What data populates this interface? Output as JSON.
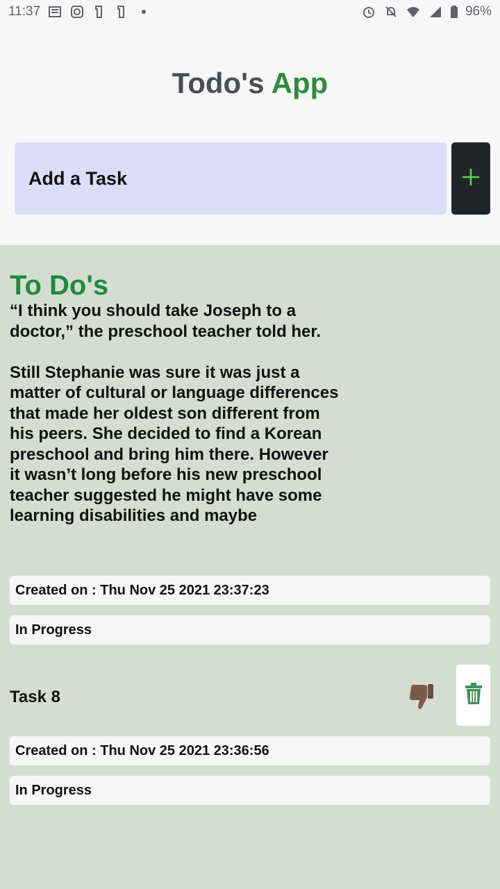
{
  "status_bar": {
    "time": "11:37",
    "battery": "96%",
    "left_icons": [
      "news-icon",
      "instagram-icon",
      "app-icon",
      "app-icon"
    ],
    "right_icons": [
      "alarm-icon",
      "notifications-off-icon",
      "wifi-icon",
      "signal-icon",
      "battery-icon"
    ]
  },
  "header": {
    "title_part1": "Todo's",
    "title_part2": "App",
    "accent_color": "#2e8b3e"
  },
  "add_task": {
    "placeholder": "Add a Task",
    "add_button_icon": "plus-icon"
  },
  "todos": {
    "section_title": "To Do's",
    "items": [
      {
        "text": "“I think you should take Joseph to a\ndoctor,” the preschool teacher told her.\n\nStill Stephanie was sure it was just a\nmatter of cultural or language differences\nthat made her oldest son different from\nhis peers. She decided to find a Korean\npreschool and bring him there. However\nit wasn’t long before his new preschool\nteacher suggested he might have some\nlearning disabilities and maybe",
        "created": "Created on : Thu Nov 25 2021 23:37:23",
        "status": "In Progress"
      },
      {
        "text": "Task 8",
        "created": "Created on : Thu Nov 25 2021 23:36:56",
        "status": "In Progress"
      }
    ]
  }
}
